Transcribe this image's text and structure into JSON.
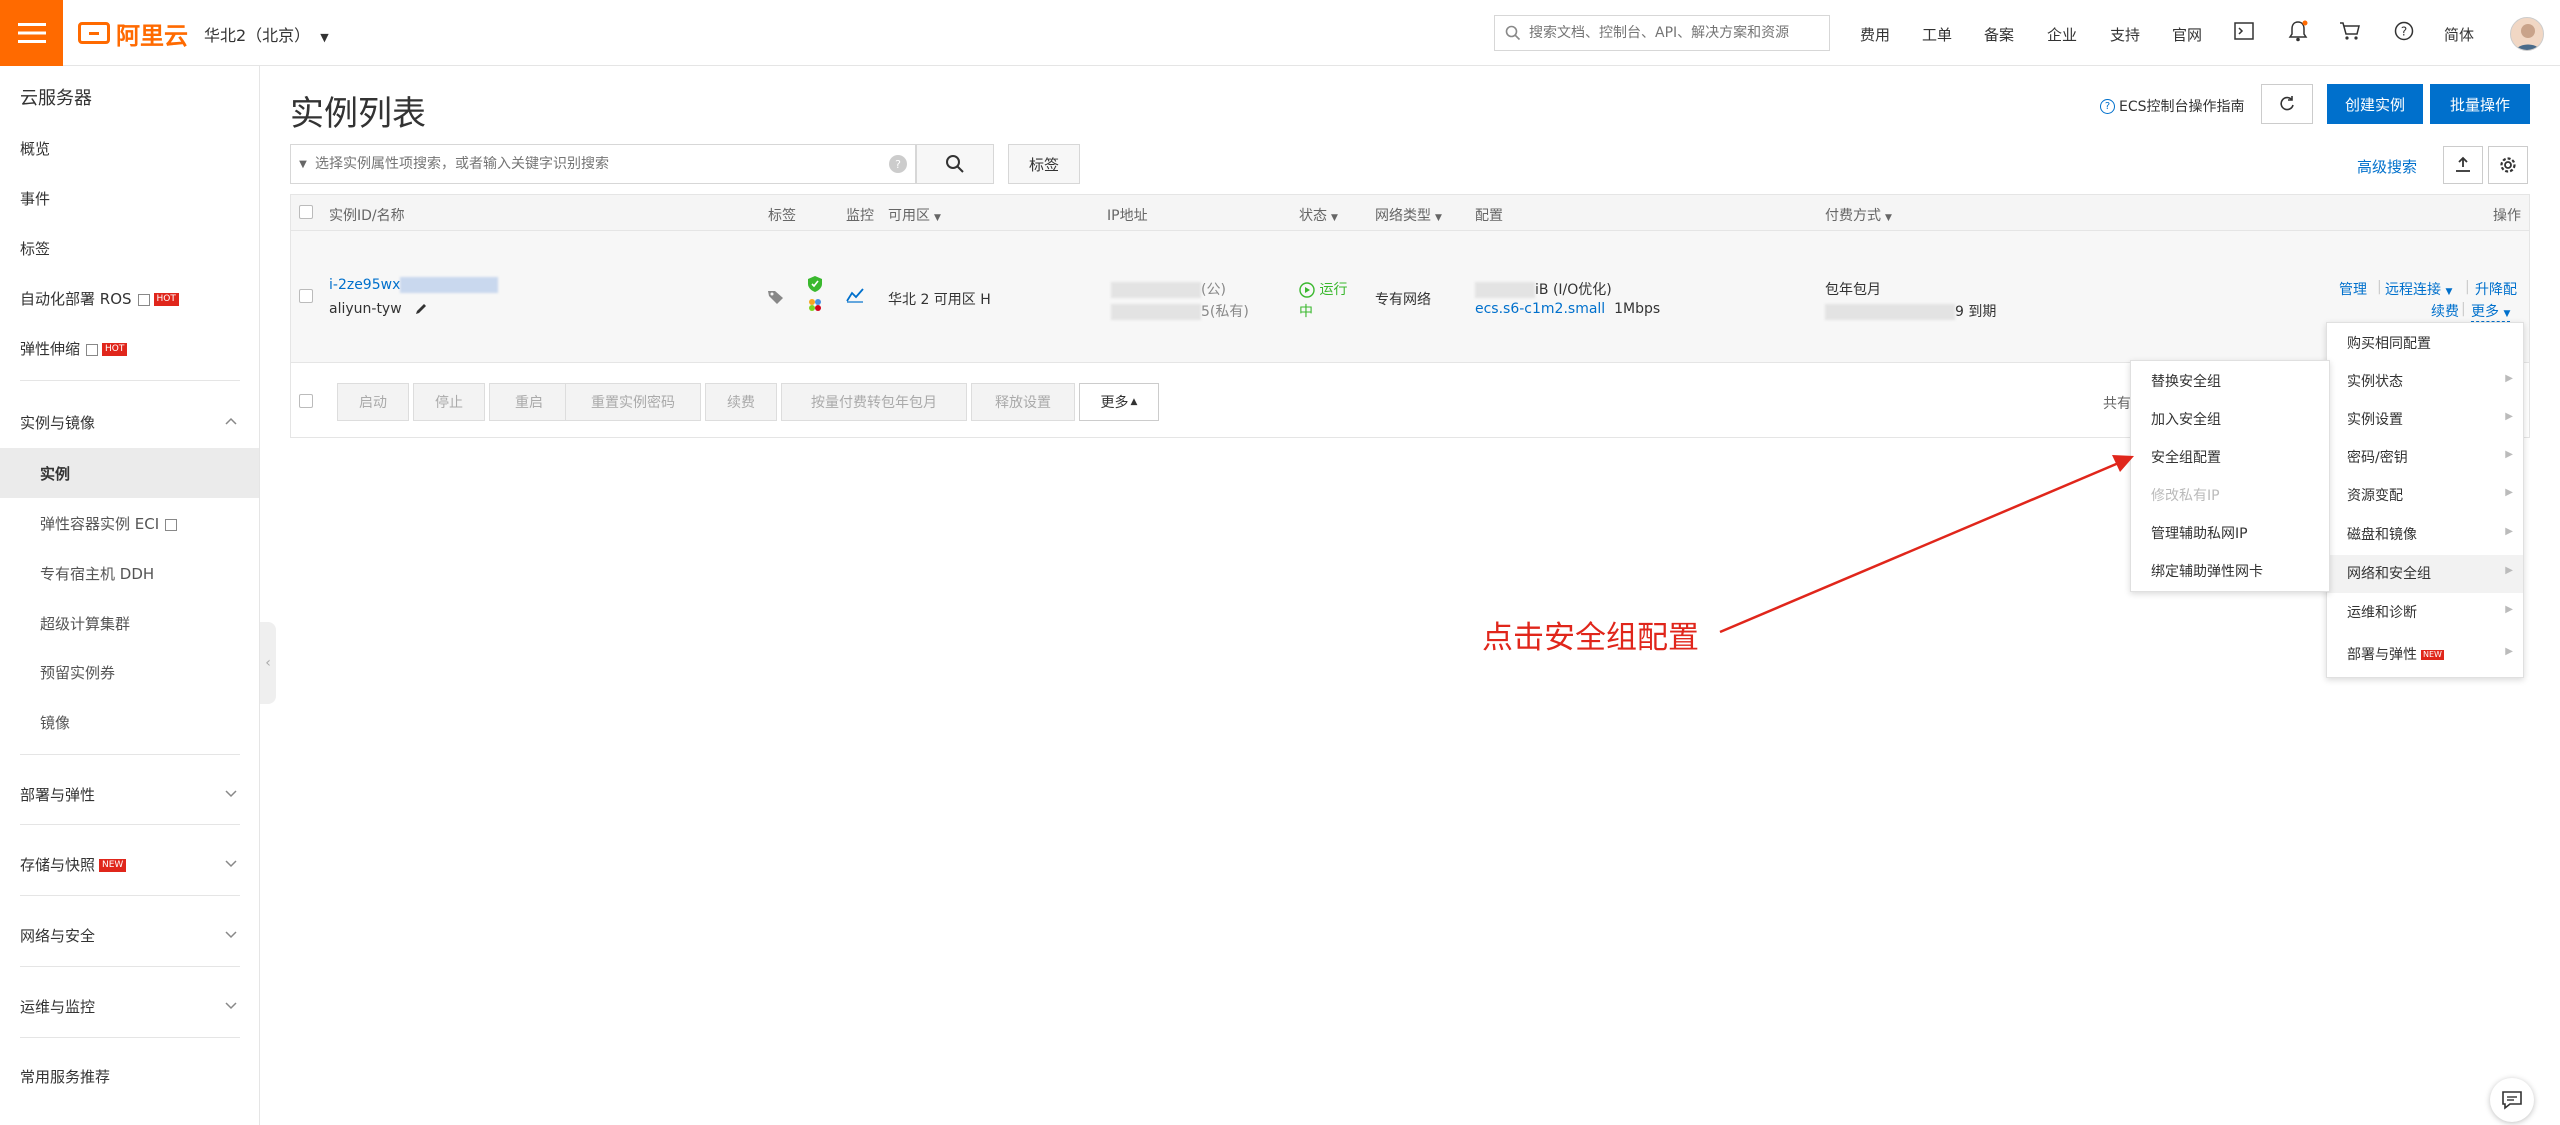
{
  "topbar": {
    "logo_text": "阿里云",
    "region": "华北2（北京）",
    "search_placeholder": "搜索文档、控制台、API、解决方案和资源",
    "links": [
      "费用",
      "工单",
      "备案",
      "企业",
      "支持",
      "官网"
    ],
    "lang": "简体"
  },
  "sidebar": {
    "title": "云服务器",
    "items_top": [
      "概览",
      "事件",
      "标签"
    ],
    "ros": "自动化部署 ROS",
    "elastic": "弹性伸缩",
    "hot": "HOT",
    "new": "NEW",
    "group_instances": "实例与镜像",
    "sub_items": [
      "实例",
      "弹性容器实例 ECI",
      "专有宿主机 DDH",
      "超级计算集群",
      "预留实例券",
      "镜像"
    ],
    "groups": [
      "部署与弹性",
      "存储与快照",
      "网络与安全",
      "运维与监控"
    ],
    "recommend": "常用服务推荐"
  },
  "main": {
    "title": "实例列表",
    "guide": "ECS控制台操作指南",
    "create": "创建实例",
    "batch": "批量操作",
    "filter_placeholder": "选择实例属性项搜索，或者输入关键字识别搜索",
    "tag_button": "标签",
    "advanced_search": "高级搜索"
  },
  "table": {
    "headers": [
      "实例ID/名称",
      "标签",
      "监控",
      "可用区",
      "IP地址",
      "状态",
      "网络类型",
      "配置",
      "付费方式",
      "操作"
    ],
    "row": {
      "id": "i-2ze95wx",
      "name": "aliyun-tyw",
      "zone": "华北 2 可用区 H",
      "ip_public": "(公)",
      "ip_private": "5(私有)",
      "status_line1": "运行",
      "status_line2": "中",
      "network": "专有网络",
      "config1": "iB (I/O优化)",
      "config2": "ecs.s6-c1m2.small",
      "bandwidth": "1Mbps",
      "billing": "包年包月",
      "expire": "9 到期",
      "op_manage": "管理",
      "op_remote": "远程连接",
      "op_upgrade": "升降配",
      "op_renew": "续费",
      "op_more": "更多"
    },
    "footer_buttons": [
      "启动",
      "停止",
      "重启",
      "重置实例密码",
      "续费",
      "按量付费转包年包月",
      "释放设置",
      "更多"
    ],
    "footer_total": "共有"
  },
  "menu_main": [
    "购买相同配置",
    "实例状态",
    "实例设置",
    "密码/密钥",
    "资源变配",
    "磁盘和镜像",
    "网络和安全组",
    "运维和诊断",
    "部署与弹性"
  ],
  "menu_sub": [
    "替换安全组",
    "加入安全组",
    "安全组配置",
    "修改私有IP",
    "管理辅助私网IP",
    "绑定辅助弹性网卡"
  ],
  "annotation": "点击安全组配置",
  "colors": {
    "brand_orange": "#ff6a00",
    "primary_blue": "#0070cc",
    "annotation_red": "#e0261b",
    "running_green": "#3ab82e"
  }
}
